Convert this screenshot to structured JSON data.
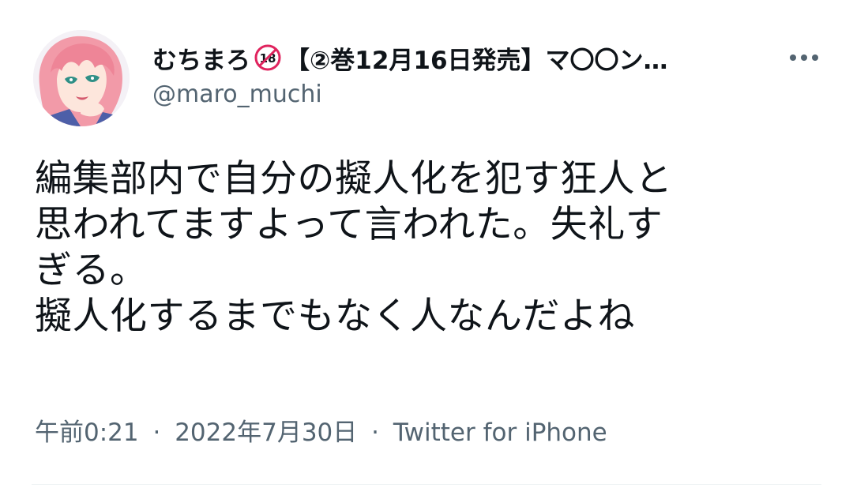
{
  "author": {
    "display_name_prefix": "むちまろ",
    "badge_text": "18",
    "display_name_suffix": "【②巻12月16日発売】マ〇〇ン…",
    "handle": "@maro_muchi"
  },
  "tweet": {
    "text": "編集部内で自分の擬人化を犯す狂人と\n思われてますよって言われた。失礼す\nぎる。\n擬人化するまでもなく人なんだよね"
  },
  "meta": {
    "time": "午前0:21",
    "separator": "·",
    "date": "2022年7月30日",
    "source": "Twitter for iPhone"
  },
  "icons": {
    "more": "more-horizontal-icon",
    "badge": "r18-icon",
    "avatar": "anime-avatar"
  },
  "colors": {
    "text_primary": "#0f1419",
    "text_secondary": "#536471",
    "badge_red": "#e0245e",
    "avatar_hair": "#f29aa8"
  }
}
